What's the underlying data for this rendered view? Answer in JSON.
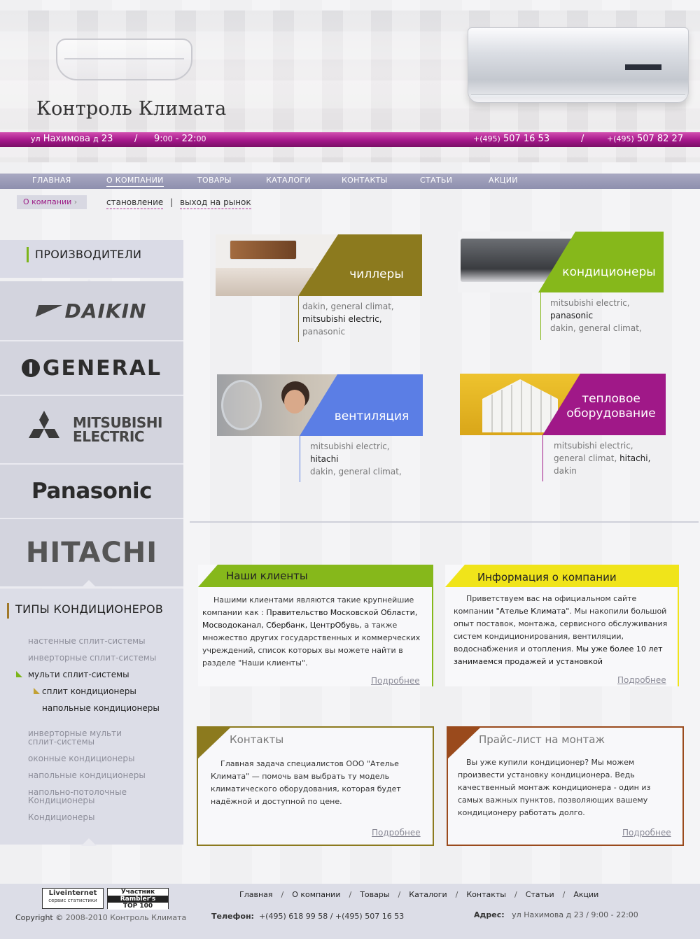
{
  "header": {
    "brand": "Контроль Климата",
    "address_prefix": "ул",
    "address_street": "Нахимова",
    "address_d": "д",
    "address_num": "23",
    "sep": "/",
    "hours_open": "9:",
    "hours_open_min": "00",
    "hours_dash": "- 22:",
    "hours_close_min": "00",
    "phone1_code": "+(495)",
    "phone1_num": "507 16 53",
    "phone2_code": "+(495)",
    "phone2_num": "507 82 27"
  },
  "nav": {
    "items": [
      "ГЛАВНАЯ",
      "О КОМПАНИИ",
      "ТОВАРЫ",
      "КАТАЛОГИ",
      "КОНТАКТЫ",
      "СТАТЬИ",
      "АКЦИИ"
    ]
  },
  "subnav": {
    "crumb": "О компании",
    "crumb_arrow": "›",
    "link1": "становление",
    "sep": "|",
    "link2": "выход на рынок"
  },
  "sidebar": {
    "manufacturers_title": "ПРОИЗВОДИТЕЛИ",
    "brands": [
      "DAIKIN",
      "GENERAL",
      "MITSUBISHI",
      "ELECTRIC",
      "Panasonic",
      "HITACHI"
    ],
    "types_title": "ТИПЫ КОНДИЦИОНЕРОВ",
    "types": [
      "настенные сплит-системы",
      "инверторные сплит-системы",
      "мульти сплит-системы",
      "сплит кондиционеры",
      "напольные кондиционеры",
      "инверторные мульти",
      "сплит-системы",
      "оконные кондиционеры",
      "напольные кондиционеры",
      "напольно-потолочные",
      "Кондиционеры",
      "Кондиционеры"
    ]
  },
  "categories": [
    {
      "label": "чиллеры",
      "b1": "dakin, general climat,",
      "b2": "mitsubishi electric,",
      "b3": "panasonic",
      "color": "#8c7a1e"
    },
    {
      "label": "кондиционеры",
      "b1": "mitsubishi electric,",
      "b2": "panasonic",
      "b3": "dakin, general climat,",
      "color": "#86b81b"
    },
    {
      "label": "вентиляция",
      "b1": "mitsubishi electric,",
      "b2": "hitachi",
      "b3": "dakin, general climat,",
      "color": "#5b7ee5"
    },
    {
      "label1": "тепловое",
      "label2": "оборудование",
      "b1": "mitsubishi electric,",
      "b2a": "general climat, ",
      "b2b": "hitachi,",
      "b3": "dakin",
      "color": "#a01888"
    }
  ],
  "boxes": {
    "clients": {
      "title": "Наши клиенты",
      "l1": "Нашими клиентами являются такие крупнейшие",
      "l2a": "компании как : ",
      "l2b": "Правительство Московской Области,",
      "l3a": "Мосводоканал, Сбербанк, ЦентрОбувь",
      "l3b": ", а также",
      "l4": "множество других государственных и коммерческих",
      "l5": "учреждений, список которых вы можете найти в",
      "l6": "разделе \"Наши клиенты\".",
      "more": "Подробнее"
    },
    "info": {
      "title": "Информация о компании",
      "l1": "Приветствуем вас на официальном сайте",
      "l2a": "компании ",
      "l2b": "\"Ателье Климата\"",
      "l2c": ". Мы накопили большой",
      "l3": "опыт поставок, монтажа, сервисного обслуживания",
      "l4": "систем кондиционирования, вентиляции,",
      "l5a": "водоснабжения и отопления. ",
      "l5b": "Мы уже более 10 лет",
      "l6": "занимаемся продажей и установкой",
      "more": "Подробнее"
    },
    "contacts": {
      "title": "Контакты",
      "l1": "Главная задача специалистов ООО \"Ателье",
      "l2": "Климата\" — помочь вам выбрать ту модель",
      "l3": "климатического оборудования, которая будет",
      "l4": "надёжной и доступной по цене.",
      "more": "Подробнее"
    },
    "price": {
      "title": "Прайс-лист на монтаж",
      "l1": "Вы уже купили кондиционер? Мы можем",
      "l2": "произвести установку кондиционера. Ведь",
      "l3": "качественный монтаж кондиционера - один из",
      "l4": "самых важных пунктов, позволяющих вашему",
      "l5": "кондиционеру работать долго.",
      "more": "Подробнее"
    }
  },
  "footer": {
    "badge1": "Liveinternet",
    "badge1_sub": "сервис статистики",
    "badge2_l1": "Участник",
    "badge2_l2": "Rambler's",
    "badge2_l3": "TOP 100",
    "nav": [
      "Главная",
      "О компании",
      "Товары",
      "Каталоги",
      "Контакты",
      "Статьи",
      "Акции"
    ],
    "nav_sep": "/",
    "copyright_a": "Copyright ©",
    "copyright_b": "2008-2010 Контроль Климата",
    "phone_label": "Телефон:",
    "phone_value": "+(495) 618 99 58 / +(495) 507 16 53",
    "address_label": "Адрес:",
    "address_value": "ул Нахимова д 23  / 9:00 - 22:00"
  },
  "colors": {
    "accent_pink": "#a4178a",
    "accent_green": "#86b81b",
    "accent_olive": "#8c7a1e",
    "accent_blue": "#5b7ee5",
    "accent_yellow": "#f0e41a",
    "accent_brown": "#9a4a1c",
    "nav_bg": "#9a9bb8"
  }
}
